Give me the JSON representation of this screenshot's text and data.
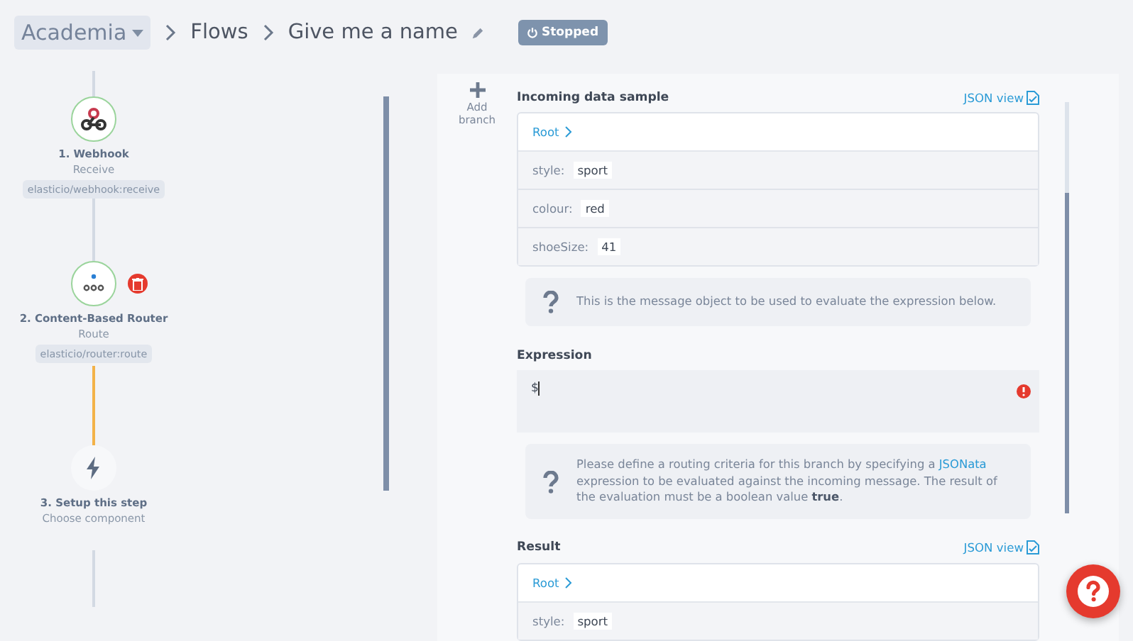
{
  "breadcrumb": {
    "workspace": "Academia",
    "section": "Flows",
    "flow_name": "Give me a name"
  },
  "status_badge": {
    "label": "Stopped"
  },
  "steps": [
    {
      "kind": "webhook",
      "title": "1. Webhook",
      "subtitle": "Receive",
      "component": "elasticio/webhook:receive",
      "deletable": false
    },
    {
      "kind": "router",
      "title": "2. Content-Based Router",
      "subtitle": "Route",
      "component": "elasticio/router:route",
      "deletable": true
    },
    {
      "kind": "placeholder",
      "title": "3. Setup this step",
      "subtitle": "Choose component",
      "deletable": false
    }
  ],
  "add_branch": {
    "label": "Add branch"
  },
  "incoming": {
    "title": "Incoming data sample",
    "json_view": "JSON view",
    "path": "Root",
    "fields": [
      {
        "key": "style:",
        "value": "sport"
      },
      {
        "key": "colour:",
        "value": "red"
      },
      {
        "key": "shoeSize:",
        "value": "41"
      }
    ],
    "hint": "This is the message object to be used to evaluate the expression below."
  },
  "expression": {
    "title": "Expression",
    "value": "$",
    "error": true,
    "hint": {
      "before": "Please define a routing criteria for this branch by specifying a",
      "link": "JSONata",
      "after": "expression to be evaluated against the incoming message. The result of the evaluation must be a boolean value **true**."
    }
  },
  "result": {
    "title": "Result",
    "json_view": "JSON view",
    "path": "Root",
    "fields": [
      {
        "key": "style:",
        "value": "sport"
      }
    ]
  }
}
